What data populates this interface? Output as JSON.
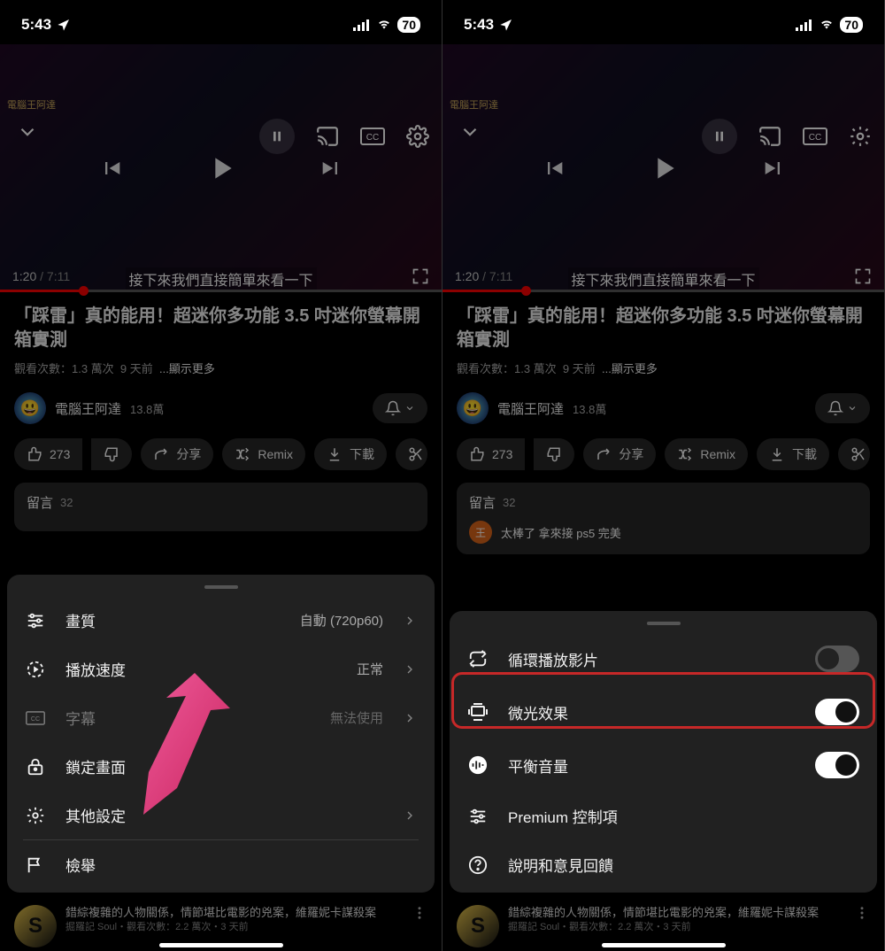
{
  "status": {
    "time": "5:43",
    "battery": "70"
  },
  "video": {
    "watermark": "電腦王阿達",
    "current_time": "1:20",
    "total_time": "7:11",
    "caption": "接下來我們直接簡單來看一下"
  },
  "title": "「踩雷」真的能用！超迷你多功能 3.5 吋迷你螢幕開箱實測",
  "stats": {
    "views": "觀看次數：1.3 萬次",
    "age": "9 天前",
    "more": "...顯示更多"
  },
  "channel": {
    "name": "電腦王阿達",
    "subs": "13.8萬"
  },
  "chips": {
    "like": "273",
    "share": "分享",
    "remix": "Remix",
    "download": "下載"
  },
  "comments": {
    "label": "留言",
    "count": "32",
    "sample_avatar": "王",
    "sample_text": "太棒了 拿來接 ps5 完美"
  },
  "sheet_left": {
    "quality": {
      "label": "畫質",
      "value": "自動 (720p60)"
    },
    "speed": {
      "label": "播放速度",
      "value": "正常"
    },
    "captions": {
      "label": "字幕",
      "value": "無法使用"
    },
    "lock": {
      "label": "鎖定畫面"
    },
    "more": {
      "label": "其他設定"
    },
    "report": {
      "label": "檢舉"
    }
  },
  "sheet_right": {
    "loop": {
      "label": "循環播放影片"
    },
    "ambient": {
      "label": "微光效果"
    },
    "volume": {
      "label": "平衡音量"
    },
    "premium": {
      "label": "Premium 控制項"
    },
    "feedback": {
      "label": "說明和意見回饋"
    }
  },
  "related": {
    "thumb_letter": "S",
    "line1": "錯綜複雜的人物關係，情節堪比電影的兇案，維羅妮卡謀殺案",
    "line2": "掘羅記 Soul・觀看次數：2.2 萬次・3 天前"
  }
}
